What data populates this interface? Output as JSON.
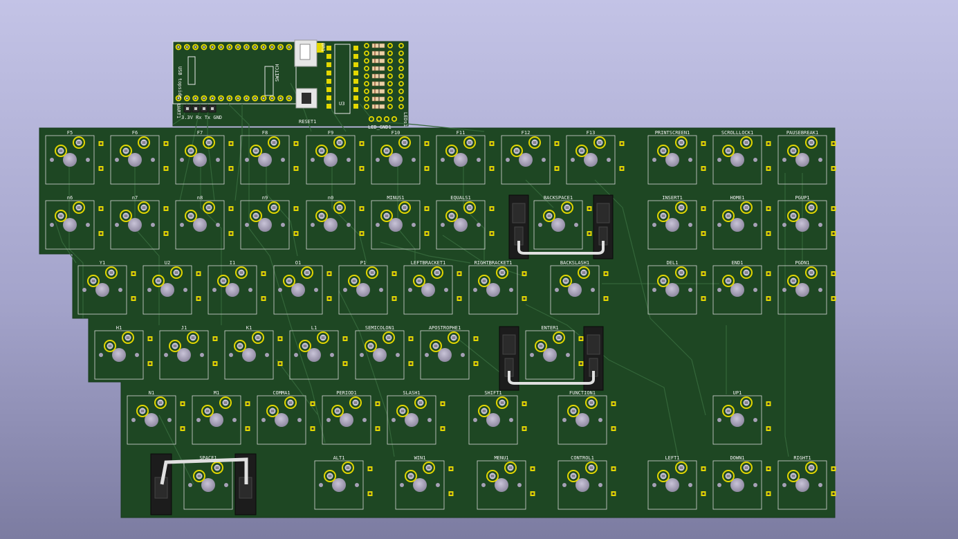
{
  "viewer": {
    "title": "",
    "view": "3D viewer",
    "colors": {
      "background_top": "#c3c3e6",
      "background_bottom": "#7c7ca1",
      "board": "#1e4723",
      "silkscreen": "#e8e8e8",
      "pad_gold": "#e3d700",
      "hole": "#a6a0b6",
      "stabilizer": "#1a1a1a"
    }
  },
  "controller_module": {
    "usb_label": "USB topside",
    "uart_ref": "UART1",
    "uart_pins": "3.3V Rx Tx GND",
    "switch_ref": "SWITCH",
    "reset_ref": "RESET1",
    "chip_ref": "U3",
    "resistor_ref": "BR1",
    "led_gnd_ref": "LED_GND1",
    "led_ref": "LEDs1"
  },
  "keys": [
    {
      "label": "F5",
      "icon": "key-switch-icon"
    },
    {
      "label": "F6",
      "icon": "key-switch-icon"
    },
    {
      "label": "F7",
      "icon": "key-switch-icon"
    },
    {
      "label": "F8",
      "icon": "key-switch-icon"
    },
    {
      "label": "F9",
      "icon": "key-switch-icon"
    },
    {
      "label": "F10",
      "icon": "key-switch-icon"
    },
    {
      "label": "F11",
      "icon": "key-switch-icon"
    },
    {
      "label": "F12",
      "icon": "key-switch-icon"
    },
    {
      "label": "F13",
      "icon": "key-switch-icon"
    },
    {
      "label": "PRINTSCREEN1",
      "icon": "key-switch-icon"
    },
    {
      "label": "SCROLLLOCK1",
      "icon": "key-switch-icon"
    },
    {
      "label": "PAUSEBREAK1",
      "icon": "key-switch-icon"
    },
    {
      "label": "n6",
      "icon": "key-switch-icon"
    },
    {
      "label": "n7",
      "icon": "key-switch-icon"
    },
    {
      "label": "n8",
      "icon": "key-switch-icon"
    },
    {
      "label": "n9",
      "icon": "key-switch-icon"
    },
    {
      "label": "n0",
      "icon": "key-switch-icon"
    },
    {
      "label": "MINUS1",
      "icon": "key-switch-icon"
    },
    {
      "label": "EQUALS1",
      "icon": "key-switch-icon"
    },
    {
      "label": "BACKSPACE1",
      "icon": "key-switch-icon"
    },
    {
      "label": "INSERT1",
      "icon": "key-switch-icon"
    },
    {
      "label": "HOME1",
      "icon": "key-switch-icon"
    },
    {
      "label": "PGUP1",
      "icon": "key-switch-icon"
    },
    {
      "label": "Y1",
      "icon": "key-switch-icon"
    },
    {
      "label": "U2",
      "icon": "key-switch-icon"
    },
    {
      "label": "I1",
      "icon": "key-switch-icon"
    },
    {
      "label": "O1",
      "icon": "key-switch-icon"
    },
    {
      "label": "P1",
      "icon": "key-switch-icon"
    },
    {
      "label": "LEFTBRACKET1",
      "icon": "key-switch-icon"
    },
    {
      "label": "RIGHTBRACKET1",
      "icon": "key-switch-icon"
    },
    {
      "label": "BACKSLASH1",
      "icon": "key-switch-icon"
    },
    {
      "label": "DEL1",
      "icon": "key-switch-icon"
    },
    {
      "label": "END1",
      "icon": "key-switch-icon"
    },
    {
      "label": "PGDN1",
      "icon": "key-switch-icon"
    },
    {
      "label": "H1",
      "icon": "key-switch-icon"
    },
    {
      "label": "J1",
      "icon": "key-switch-icon"
    },
    {
      "label": "K1",
      "icon": "key-switch-icon"
    },
    {
      "label": "L1",
      "icon": "key-switch-icon"
    },
    {
      "label": "SEMICOLON1",
      "icon": "key-switch-icon"
    },
    {
      "label": "APOSTROPHE1",
      "icon": "key-switch-icon"
    },
    {
      "label": "ENTER1",
      "icon": "key-switch-icon"
    },
    {
      "label": "N1",
      "icon": "key-switch-icon"
    },
    {
      "label": "M1",
      "icon": "key-switch-icon"
    },
    {
      "label": "COMMA1",
      "icon": "key-switch-icon"
    },
    {
      "label": "PERIOD1",
      "icon": "key-switch-icon"
    },
    {
      "label": "SLASH1",
      "icon": "key-switch-icon"
    },
    {
      "label": "SHIFT1",
      "icon": "key-switch-icon"
    },
    {
      "label": "FUNCTION1",
      "icon": "key-switch-icon"
    },
    {
      "label": "UP1",
      "icon": "key-switch-icon"
    },
    {
      "label": "SPACE1",
      "icon": "key-switch-icon"
    },
    {
      "label": "ALT1",
      "icon": "key-switch-icon"
    },
    {
      "label": "WIN1",
      "icon": "key-switch-icon"
    },
    {
      "label": "MENU1",
      "icon": "key-switch-icon"
    },
    {
      "label": "CONTROL1",
      "icon": "key-switch-icon"
    },
    {
      "label": "LEFT1",
      "icon": "key-switch-icon"
    },
    {
      "label": "DOWN1",
      "icon": "key-switch-icon"
    },
    {
      "label": "RIGHT1",
      "icon": "key-switch-icon"
    }
  ]
}
